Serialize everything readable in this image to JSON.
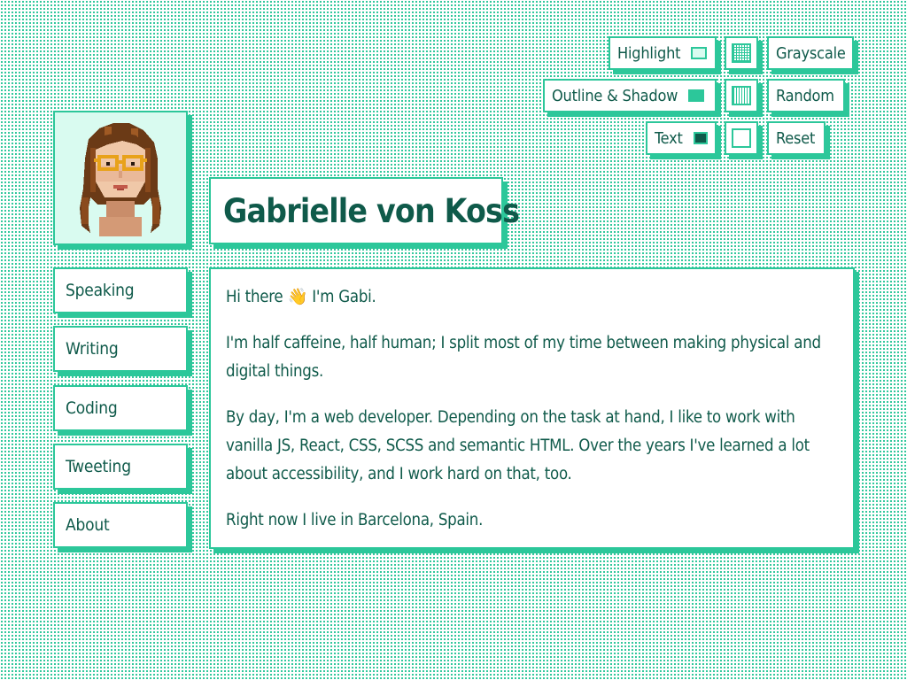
{
  "controls": {
    "highlight_label": "Highlight",
    "outline_shadow_label": "Outline & Shadow",
    "text_label": "Text",
    "grayscale_label": "Grayscale",
    "random_label": "Random",
    "reset_label": "Reset",
    "colors": {
      "highlight": "#d9fbf0",
      "outline_shadow": "#2cc79a",
      "text": "#0f5a4a"
    }
  },
  "profile": {
    "name": "Gabrielle von Koss"
  },
  "nav": {
    "items": [
      {
        "label": "Speaking"
      },
      {
        "label": "Writing"
      },
      {
        "label": "Coding"
      },
      {
        "label": "Tweeting"
      },
      {
        "label": "About"
      }
    ]
  },
  "content": {
    "greeting": "Hi there 👋 I'm Gabi.",
    "p1": "I'm half caffeine, half human; I split most of my time between making physical and digital things.",
    "p2": "By day, I'm a web developer. Depending on the task at hand, I like to work with vanilla JS, React, CSS, SCSS and semantic HTML. Over the years I've learned a lot about accessibility, and I work hard on that, too.",
    "p3": "Right now I live in Barcelona, Spain."
  }
}
